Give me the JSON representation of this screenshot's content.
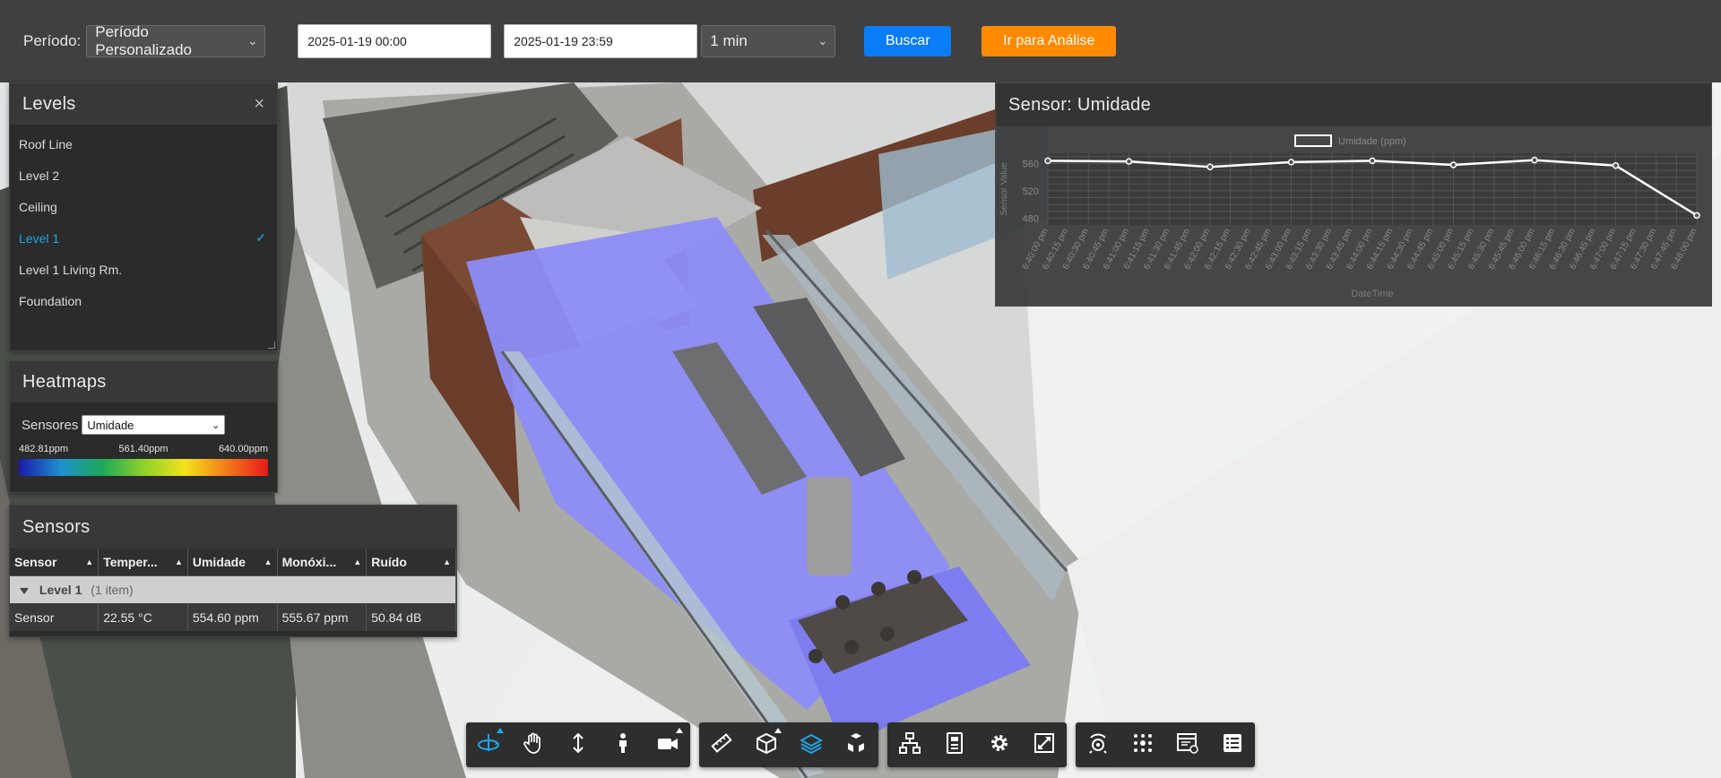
{
  "toolbar": {
    "period_label": "Período:",
    "period_value": "Período Personalizado",
    "start_date": "2025-01-19 00:00",
    "end_date": "2025-01-19 23:59",
    "interval": "1 min",
    "search_label": "Buscar",
    "analysis_label": "Ir para Análise",
    "search_color": "#0a7cf5",
    "analysis_color": "#ff8a00"
  },
  "levels": {
    "title": "Levels",
    "items": [
      {
        "label": "Roof Line",
        "active": false
      },
      {
        "label": "Level 2",
        "active": false
      },
      {
        "label": "Ceiling",
        "active": false
      },
      {
        "label": "Level 1",
        "active": true
      },
      {
        "label": "Level 1 Living Rm.",
        "active": false
      },
      {
        "label": "Foundation",
        "active": false
      }
    ],
    "active_color": "#1fa6e6"
  },
  "heatmaps": {
    "title": "Heatmaps",
    "sensor_label": "Sensores",
    "sensor_value": "Umidade",
    "scale_min": "482.81ppm",
    "scale_mid": "561.40ppm",
    "scale_max": "640.00ppm"
  },
  "sensors": {
    "title": "Sensors",
    "columns": [
      "Sensor",
      "Temper...",
      "Umidade",
      "Monóxi...",
      "Ruído"
    ],
    "group_label": "Level 1",
    "group_count": "(1 item)",
    "rows": [
      {
        "sensor": "Sensor",
        "temperature": "22.55 °C",
        "humidity": "554.60 ppm",
        "monoxide": "555.67 ppm",
        "noise": "50.84 dB"
      }
    ]
  },
  "chart_panel": {
    "title": "Sensor: Umidade"
  },
  "chart_data": {
    "type": "line",
    "legend": "Umidade (ppm)",
    "xlabel": "DateTime",
    "ylabel": "Sensor Value",
    "ylim": [
      470,
      575
    ],
    "yticks": [
      480,
      520,
      560
    ],
    "categories": [
      "6:40:00 pm",
      "6:40:15 pm",
      "6:40:30 pm",
      "6:40:45 pm",
      "6:41:00 pm",
      "6:41:15 pm",
      "6:41:30 pm",
      "6:41:45 pm",
      "6:42:00 pm",
      "6:42:15 pm",
      "6:42:30 pm",
      "6:42:45 pm",
      "6:43:00 pm",
      "6:43:15 pm",
      "6:43:30 pm",
      "6:43:45 pm",
      "6:44:00 pm",
      "6:44:15 pm",
      "6:44:30 pm",
      "6:44:45 pm",
      "6:45:00 pm",
      "6:45:15 pm",
      "6:45:30 pm",
      "6:45:45 pm",
      "6:46:00 pm",
      "6:46:15 pm",
      "6:46:30 pm",
      "6:46:45 pm",
      "6:47:00 pm",
      "6:47:15 pm",
      "6:47:30 pm",
      "6:47:45 pm",
      "6:48:00 pm"
    ],
    "points": [
      {
        "x": "6:40:00 pm",
        "y": 564
      },
      {
        "x": "6:41:00 pm",
        "y": 563
      },
      {
        "x": "6:42:00 pm",
        "y": 555
      },
      {
        "x": "6:43:00 pm",
        "y": 562
      },
      {
        "x": "6:44:00 pm",
        "y": 564
      },
      {
        "x": "6:45:00 pm",
        "y": 558
      },
      {
        "x": "6:46:00 pm",
        "y": 565
      },
      {
        "x": "6:47:00 pm",
        "y": 557
      },
      {
        "x": "6:48:00 pm",
        "y": 484
      }
    ],
    "line_color": "#ffffff",
    "grid": true,
    "legend_position": "top-center"
  },
  "bottom_toolbar": {
    "groups": [
      [
        "orbit-icon",
        "pan-icon",
        "zoom-icon",
        "first-person-icon",
        "camera-icon"
      ],
      [
        "measure-icon",
        "section-icon",
        "layers-icon",
        "explode-icon"
      ],
      [
        "model-browser-icon",
        "properties-icon",
        "settings-icon",
        "fullscreen-icon"
      ],
      [
        "sensor-icon",
        "heatmap-icon",
        "dashboard-icon",
        "data-grid-icon"
      ]
    ],
    "active_icons": [
      "orbit-icon",
      "layers-icon"
    ],
    "accent_color": "#1fa6e6"
  }
}
